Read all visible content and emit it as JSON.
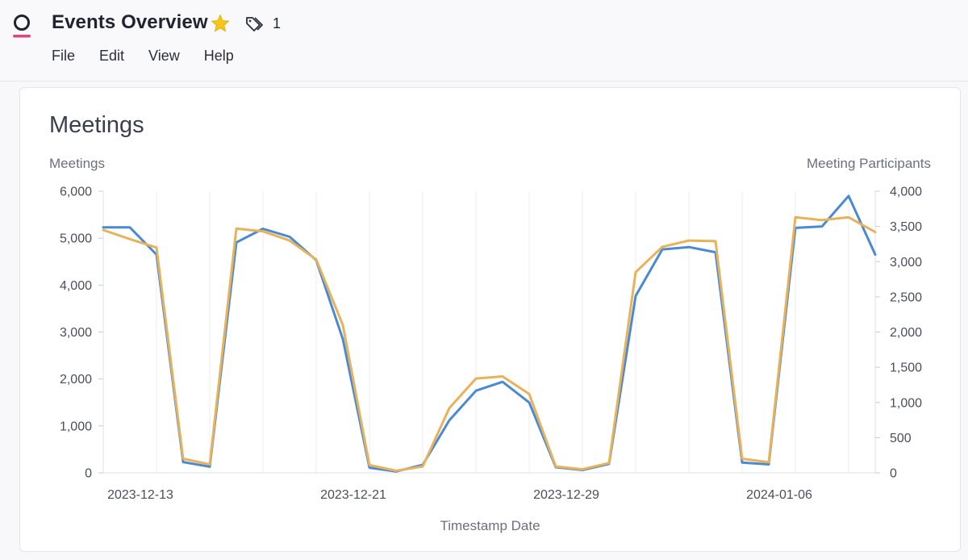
{
  "app": {
    "title": "Events Overview",
    "tag_count": "1",
    "menu": [
      "File",
      "Edit",
      "View",
      "Help"
    ]
  },
  "colors": {
    "brand": "#e0457b",
    "series_meetings": "#4a8ad4",
    "series_participants": "#e8b25a",
    "star": "#f5c518"
  },
  "icons": [
    "logo-icon",
    "star-icon",
    "tag-icon"
  ],
  "card": {
    "title": "Meetings"
  },
  "chart_data": {
    "type": "line",
    "xlabel": "Timestamp Date",
    "ylabel_left": "Meetings",
    "ylabel_right": "Meeting Participants",
    "ylim_left": [
      0,
      6000
    ],
    "ylim_right": [
      0,
      4000
    ],
    "yticks_left": [
      "0",
      "1,000",
      "2,000",
      "3,000",
      "4,000",
      "5,000",
      "6,000"
    ],
    "yticks_right": [
      "0",
      "500",
      "1,000",
      "1,500",
      "2,000",
      "2,500",
      "3,000",
      "3,500",
      "4,000"
    ],
    "xtick_labels": [
      {
        "label": "2023-12-13",
        "index": 0
      },
      {
        "label": "2023-12-21",
        "index": 8
      },
      {
        "label": "2023-12-29",
        "index": 16
      },
      {
        "label": "2024-01-06",
        "index": 24
      }
    ],
    "x": [
      "2023-12-13",
      "2023-12-14",
      "2023-12-15",
      "2023-12-16",
      "2023-12-17",
      "2023-12-18",
      "2023-12-19",
      "2023-12-20",
      "2023-12-21",
      "2023-12-22",
      "2023-12-23",
      "2023-12-24",
      "2023-12-25",
      "2023-12-26",
      "2023-12-27",
      "2023-12-28",
      "2023-12-29",
      "2023-12-30",
      "2023-12-31",
      "2024-01-01",
      "2024-01-02",
      "2024-01-03",
      "2024-01-04",
      "2024-01-05",
      "2024-01-06",
      "2024-01-07",
      "2024-01-08",
      "2024-01-09",
      "2024-01-10",
      "2024-01-11"
    ],
    "grid": true,
    "series": [
      {
        "name": "Meetings",
        "axis": "left",
        "values": [
          5230,
          5230,
          4650,
          230,
          130,
          4910,
          5200,
          5030,
          4530,
          2850,
          110,
          30,
          170,
          1120,
          1750,
          1940,
          1500,
          120,
          60,
          190,
          3770,
          4760,
          4810,
          4700,
          220,
          180,
          5220,
          5250,
          5900,
          4650
        ]
      },
      {
        "name": "Meeting Participants",
        "axis": "right",
        "values": [
          3450,
          3320,
          3200,
          200,
          120,
          3470,
          3430,
          3300,
          3030,
          2100,
          110,
          30,
          90,
          920,
          1340,
          1370,
          1120,
          90,
          50,
          140,
          2850,
          3210,
          3300,
          3290,
          200,
          150,
          3630,
          3590,
          3630,
          3420
        ]
      }
    ]
  }
}
